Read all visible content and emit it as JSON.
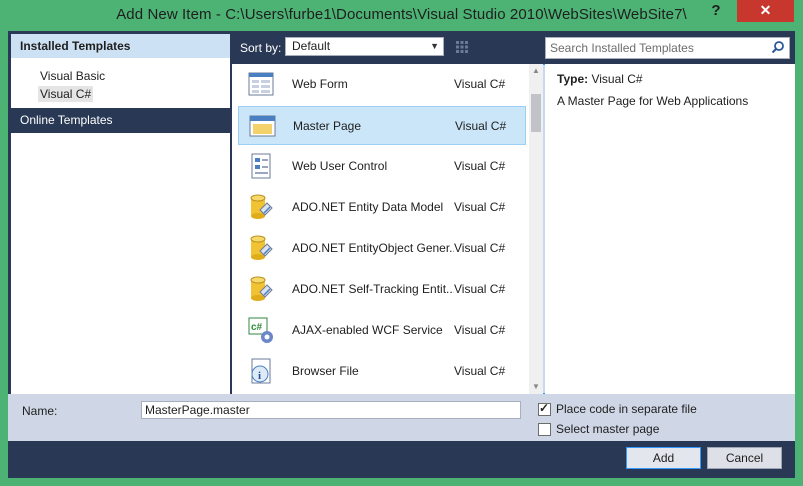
{
  "window": {
    "title": "Add New Item - C:\\Users\\furbe1\\Documents\\Visual Studio 2010\\WebSites\\WebSite7\\",
    "help_label": "?",
    "close_label": "✕"
  },
  "left_panel": {
    "header": "Installed Templates",
    "items": [
      {
        "label": "Visual Basic"
      },
      {
        "label": "Visual C#"
      }
    ],
    "online": "Online Templates"
  },
  "toolbar": {
    "sort_label": "Sort by:",
    "sort_value": "Default",
    "search_placeholder": "Search Installed Templates"
  },
  "templates": [
    {
      "name": "Web Form",
      "lang": "Visual C#",
      "icon": "web-form-icon"
    },
    {
      "name": "Master Page",
      "lang": "Visual C#",
      "icon": "master-page-icon",
      "selected": true
    },
    {
      "name": "Web User Control",
      "lang": "Visual C#",
      "icon": "user-control-icon"
    },
    {
      "name": "ADO.NET Entity Data Model",
      "lang": "Visual C#",
      "icon": "database-icon"
    },
    {
      "name": "ADO.NET EntityObject Gener...",
      "lang": "Visual C#",
      "icon": "database-icon"
    },
    {
      "name": "ADO.NET Self-Tracking Entit...",
      "lang": "Visual C#",
      "icon": "database-icon"
    },
    {
      "name": "AJAX-enabled WCF Service",
      "lang": "Visual C#",
      "icon": "csharp-service-icon"
    },
    {
      "name": "Browser File",
      "lang": "Visual C#",
      "icon": "browser-file-icon"
    }
  ],
  "details": {
    "type_label": "Type:",
    "type_value": "Visual C#",
    "description": "A Master Page for Web Applications"
  },
  "name_row": {
    "label": "Name:",
    "value": "MasterPage.master"
  },
  "options": {
    "separate_file_label": "Place code in separate file",
    "separate_file_checked": true,
    "master_page_label": "Select master page",
    "master_page_checked": false
  },
  "buttons": {
    "add": "Add",
    "cancel": "Cancel"
  },
  "colors": {
    "window_frame": "#4cb375",
    "dialog_background": "#293955",
    "close_button": "#c7372e",
    "selection": "#cbe6f8"
  }
}
